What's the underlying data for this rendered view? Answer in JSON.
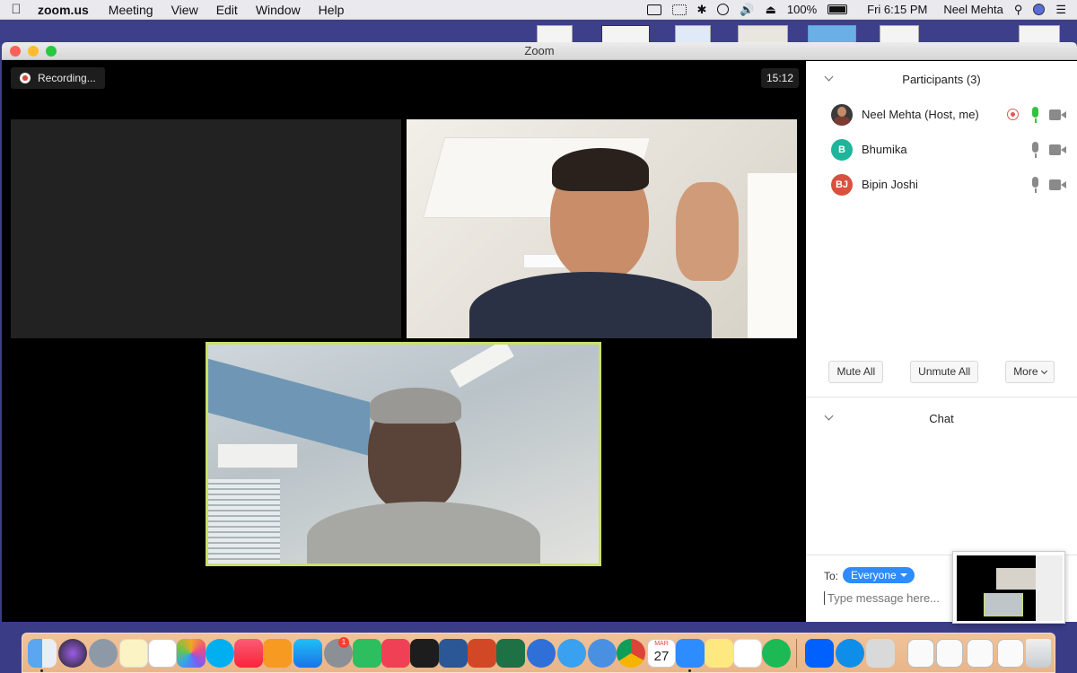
{
  "menubar": {
    "app_name": "zoom.us",
    "menus": [
      "Meeting",
      "View",
      "Edit",
      "Window",
      "Help"
    ],
    "battery": "100%",
    "clock": "Fri 6:15 PM",
    "user": "Neel Mehta"
  },
  "window": {
    "title": "Zoom",
    "recording_label": "Recording...",
    "timer": "15:12"
  },
  "participants": {
    "header": "Participants (3)",
    "list": [
      {
        "name": "Neel Mehta (Host, me)",
        "initials": "",
        "color": "#3a3a3a",
        "mic": "on",
        "recording": true
      },
      {
        "name": "Bhumika",
        "initials": "B",
        "color": "#1fb59a",
        "mic": "off",
        "recording": false
      },
      {
        "name": "Bipin Joshi",
        "initials": "BJ",
        "color": "#d9503f",
        "mic": "off",
        "recording": false
      }
    ],
    "buttons": {
      "mute_all": "Mute All",
      "unmute_all": "Unmute All",
      "more": "More"
    }
  },
  "chat": {
    "header": "Chat",
    "to_label": "To:",
    "recipient": "Everyone",
    "placeholder": "Type message here..."
  },
  "dock": {
    "calendar_month": "MAR",
    "calendar_day": "27",
    "badge_count": "1"
  },
  "colors": {
    "accent": "#2d8cff",
    "active_speaker_border": "#c9e06a",
    "mic_on": "#35c23f",
    "desktop": "#3d3f8a",
    "dock": "#f0c39a"
  }
}
